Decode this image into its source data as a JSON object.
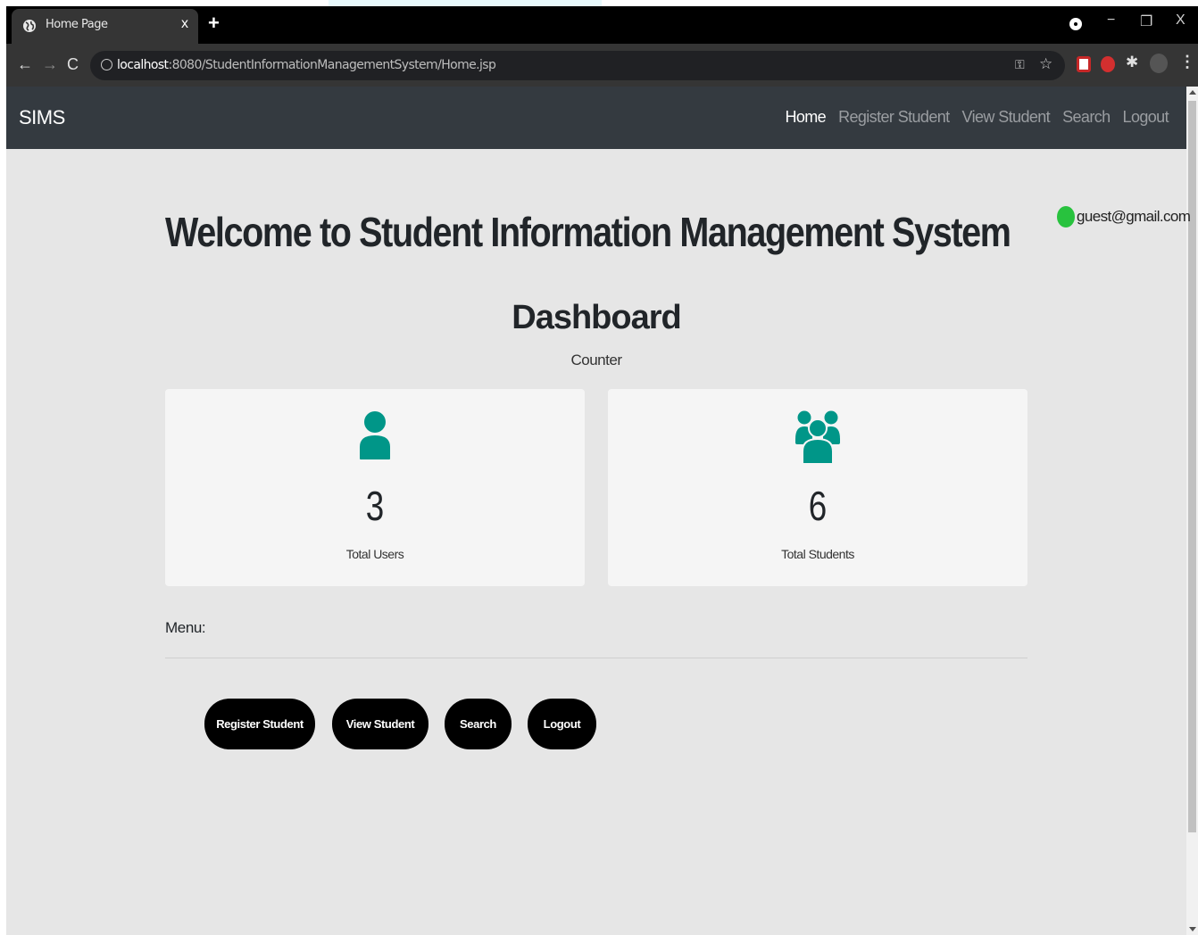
{
  "browser": {
    "tab_title": "Home Page",
    "tab_close": "x",
    "new_tab": "+",
    "url_host": "localhost",
    "url_path": ":8080/StudentInformationManagementSystem/Home.jsp",
    "window_controls": {
      "minimize": "−",
      "restore": "❐",
      "close": "X"
    }
  },
  "navbar": {
    "brand": "SIMS",
    "links": [
      {
        "label": "Home",
        "active": true
      },
      {
        "label": "Register Student",
        "active": false
      },
      {
        "label": "View Student",
        "active": false
      },
      {
        "label": "Search",
        "active": false
      },
      {
        "label": "Logout",
        "active": false
      }
    ]
  },
  "user": {
    "email": "guest@gmail.com",
    "status_color": "#28c23e"
  },
  "main": {
    "welcome": "Welcome to Student Information Management System",
    "dashboard_title": "Dashboard",
    "counter_label": "Counter",
    "cards": [
      {
        "value": "3",
        "label": "Total Users",
        "icon": "user-icon"
      },
      {
        "value": "6",
        "label": "Total Students",
        "icon": "users-icon"
      }
    ],
    "menu_label": "Menu:",
    "menu_buttons": [
      "Register Student",
      "View Student",
      "Search",
      "Logout"
    ]
  },
  "colors": {
    "accent": "#009688",
    "navbar_bg": "#343a40",
    "page_bg": "#e6e6e6"
  }
}
